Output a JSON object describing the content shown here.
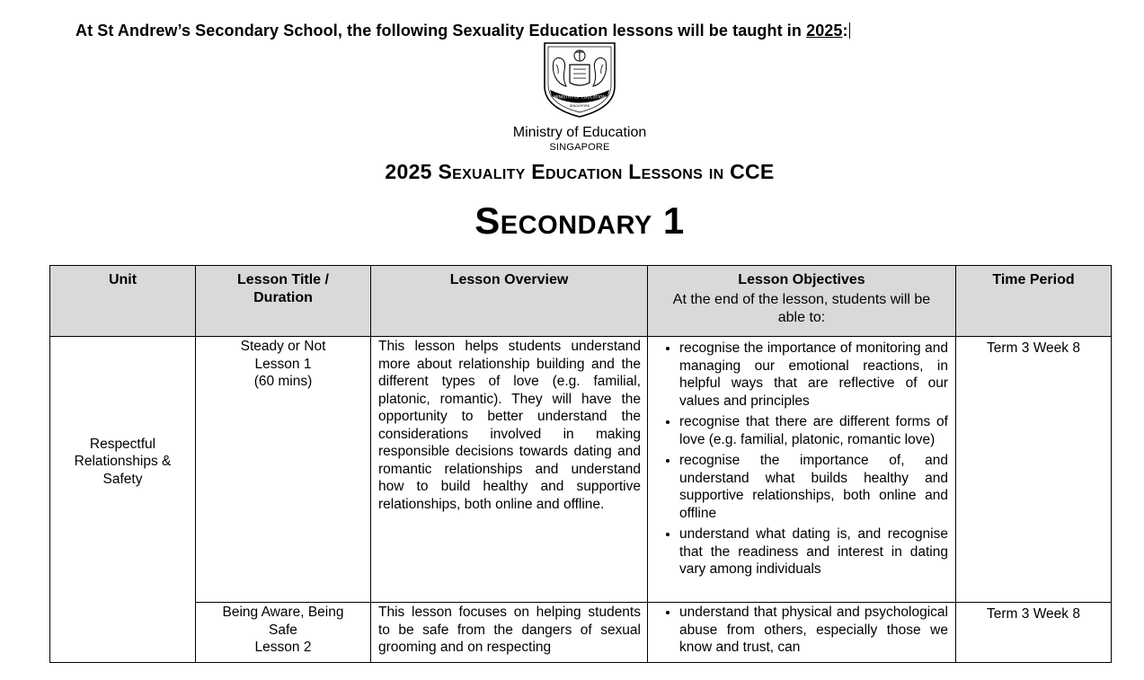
{
  "intro": {
    "prefix": "At St Andrew’s Secondary School, the following Sexuality Education lessons will be taught in ",
    "year": "2025",
    "suffix": ":"
  },
  "header": {
    "crest_motto": "MINISTRY OF EDUCATION",
    "crest_country": "SINGAPORE",
    "ministry_name": "Ministry of Education",
    "ministry_country": "SINGAPORE",
    "document_title": "2025 Sexuality Education Lessons in CCE",
    "level_title": "Secondary 1"
  },
  "table": {
    "headers": {
      "unit": "Unit",
      "lesson_title": "Lesson Title / Duration",
      "overview": "Lesson Overview",
      "objectives": "Lesson Objectives",
      "objectives_sub": "At the end of the lesson, students will be able to:",
      "time_period": "Time Period"
    },
    "unit": "Respectful Relationships & Safety",
    "rows": [
      {
        "title_lines": [
          "Steady or Not",
          "Lesson 1",
          "(60 mins)"
        ],
        "overview": "This lesson helps students understand more about relationship building and the different types of love (e.g. familial, platonic, romantic). They will have the opportunity to better understand the considerations involved in making responsible decisions towards dating and romantic relationships and understand how to build healthy and supportive relationships, both online and offline.",
        "objectives": [
          "recognise the importance of monitoring and managing our emotional reactions, in helpful ways that are reflective of our values and principles",
          "recognise that there are different forms of love (e.g. familial, platonic, romantic love)",
          "recognise the importance of, and understand what builds healthy and supportive relationships, both online and offline",
          "understand what dating is, and recognise that the readiness and interest in dating vary among individuals"
        ],
        "time_period": "Term 3 Week 8"
      },
      {
        "title_lines": [
          "Being Aware, Being Safe",
          "Lesson 2"
        ],
        "overview": "This lesson focuses on helping students to be safe from the dangers of sexual grooming and on respecting",
        "objectives": [
          "understand that physical and psychological abuse from others, especially those we know and trust, can"
        ],
        "time_period": "Term 3 Week 8"
      }
    ]
  }
}
